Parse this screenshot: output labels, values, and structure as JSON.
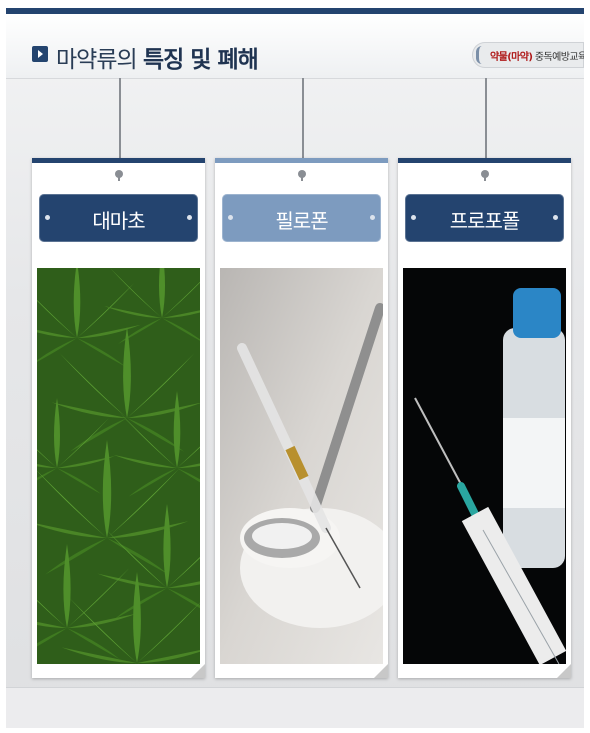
{
  "header": {
    "title_plain": "마약류의 ",
    "title_bold": "특징 및 폐해",
    "tag_accent": "약물(마약)",
    "tag_rest": " 중독예방교육"
  },
  "cards": [
    {
      "label": "대마초",
      "icon": "cannabis-leaf-photo",
      "color": "#24446f"
    },
    {
      "label": "필로폰",
      "icon": "syringe-spoon-powder-photo",
      "color": "#7d9bbf"
    },
    {
      "label": "프로포폴",
      "icon": "vial-syringe-photo",
      "color": "#24446f"
    }
  ]
}
